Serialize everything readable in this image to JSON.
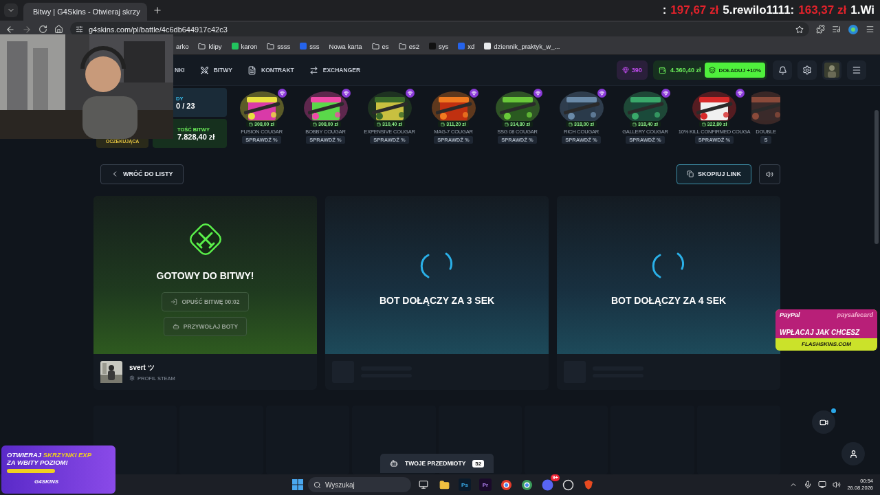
{
  "browser": {
    "tab_title": "Bitwy | G4Skins - Otwieraj skrzy",
    "url": "g4skins.com/pl/battle/4c6db644917c42c3",
    "bookmarks": [
      {
        "label": "arko",
        "kind": "plain"
      },
      {
        "label": "klipy",
        "kind": "folder"
      },
      {
        "label": "karon",
        "kind": "site"
      },
      {
        "label": "ssss",
        "kind": "folder"
      },
      {
        "label": "sss",
        "kind": "site"
      },
      {
        "label": "Nowa karta",
        "kind": "plain"
      },
      {
        "label": "es",
        "kind": "folder"
      },
      {
        "label": "es2",
        "kind": "folder"
      },
      {
        "label": "sys",
        "kind": "site"
      },
      {
        "label": "xd",
        "kind": "site"
      },
      {
        "label": "dziennik_praktyk_w_...",
        "kind": "site"
      }
    ]
  },
  "ranking": [
    {
      "text": ":",
      "kind": "plain"
    },
    {
      "text": "197,67 zł",
      "kind": "amount"
    },
    {
      "text": "5.rewilo1111:",
      "kind": "plain"
    },
    {
      "text": "163,37 zł",
      "kind": "amount"
    },
    {
      "text": "1.Wi",
      "kind": "plain"
    }
  ],
  "header": {
    "nav": [
      "NKI",
      "BITWY",
      "KONTRAKT",
      "EXCHANGER"
    ],
    "points": "390",
    "balance": "4.360,40 zł",
    "deposit": "DOŁADUJ +10%"
  },
  "battle_info": {
    "label": "DY",
    "rounds": "0 / 23",
    "value_label": "TOŚĆ BITWY",
    "value": "7.828,40 zł",
    "status": "OCZEKUJĄCA"
  },
  "cases": [
    {
      "name": "FUSION COUGAR",
      "price": "308,00 zł",
      "action": "SPRAWDŹ %"
    },
    {
      "name": "BOBBY COUGAR",
      "price": "308,00 zł",
      "action": "SPRAWDŹ %"
    },
    {
      "name": "EXPENSIVE COUGAR",
      "price": "310,40 zł",
      "action": "SPRAWDŹ %"
    },
    {
      "name": "MAG-7 COUGAR",
      "price": "311,20 zł",
      "action": "SPRAWDŹ %"
    },
    {
      "name": "SSG 08 COUGAR",
      "price": "314,80 zł",
      "action": "SPRAWDŹ %"
    },
    {
      "name": "RICH COUGAR",
      "price": "318,00 zł",
      "action": "SPRAWDŹ %"
    },
    {
      "name": "GALLERY COUGAR",
      "price": "318,40 zł",
      "action": "SPRAWDŹ %"
    },
    {
      "name": "10% KILL CONFIRMED COUGA",
      "price": "322,80 zł",
      "action": "SPRAWDŹ %"
    },
    {
      "name": "DOUBLE",
      "action": "S"
    }
  ],
  "back_button": "WRÓĆ DO LISTY",
  "copy_link": "SKOPIUJ LINK",
  "slots": [
    {
      "kind": "player",
      "title": "GOTOWY DO BITWY!",
      "buttons": [
        "OPUŚĆ BITWĘ 00:02",
        "PRZYWOŁAJ BOTY"
      ],
      "player": {
        "name": "svert ツ",
        "profile": "PROFIL STEAM"
      }
    },
    {
      "kind": "waiting",
      "title": "BOT DOŁĄCZY ZA 3 SEK"
    },
    {
      "kind": "waiting",
      "title": "BOT DOŁĄCZY ZA 4 SEK"
    }
  ],
  "inventory": {
    "label": "TWOJE PRZEDMIOTY",
    "count": "52"
  },
  "ads": {
    "payment": [
      "PayPal",
      "paysafecard"
    ],
    "slogan": "WPŁACAJ JAK CHCESZ",
    "site": "FLASHSKINS.COM",
    "exp_lines": [
      [
        {
          "text": "OTWIERAJ ",
          "highlight": false
        },
        {
          "text": "SKRZYNKI EXP",
          "highlight": true
        }
      ],
      [
        {
          "text": "ZA WBITY POZIOM!",
          "highlight": false
        }
      ]
    ],
    "exp_brand": "G4SKINS"
  },
  "taskbar": {
    "search": "Wyszukaj",
    "apps": [
      "Ps",
      "Pr"
    ],
    "badge": "9+",
    "time": "00:54",
    "date": "26.08.2026"
  }
}
